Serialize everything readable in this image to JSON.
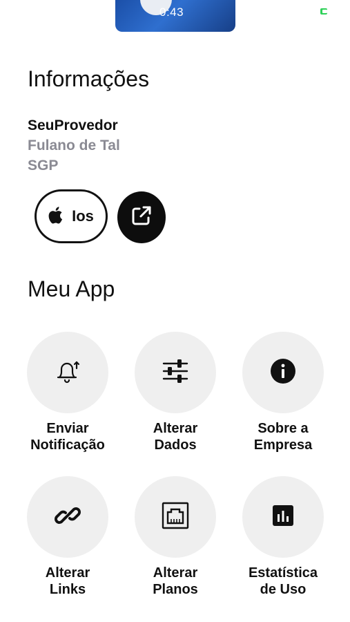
{
  "status_bar": {
    "time": "0:43",
    "icons": [
      "battery-icon"
    ]
  },
  "info": {
    "title": "Informações",
    "provider": "SeuProvedor",
    "owner": "Fulano de Tal",
    "system": "SGP",
    "ios_button_label": "Ios",
    "icons": [
      "apple-icon",
      "external-link-icon"
    ]
  },
  "app": {
    "title": "Meu App",
    "items": [
      {
        "line1": "Enviar",
        "line2": "Notificação",
        "icon": "bell-notification-icon"
      },
      {
        "line1": "Alterar",
        "line2": "Dados",
        "icon": "sliders-icon"
      },
      {
        "line1": "Sobre a",
        "line2": "Empresa",
        "icon": "info-icon"
      },
      {
        "line1": "Alterar",
        "line2": "Links",
        "icon": "link-icon"
      },
      {
        "line1": "Alterar",
        "line2": "Planos",
        "icon": "ethernet-port-icon"
      },
      {
        "line1": "Estatística",
        "line2": "de Uso",
        "icon": "bar-chart-icon"
      }
    ]
  },
  "colors": {
    "primary_text": "#111111",
    "secondary_text": "#8a8a93",
    "tile_background": "#efefef",
    "dark_button": "#0d0d0d",
    "battery": "#2ed158"
  }
}
